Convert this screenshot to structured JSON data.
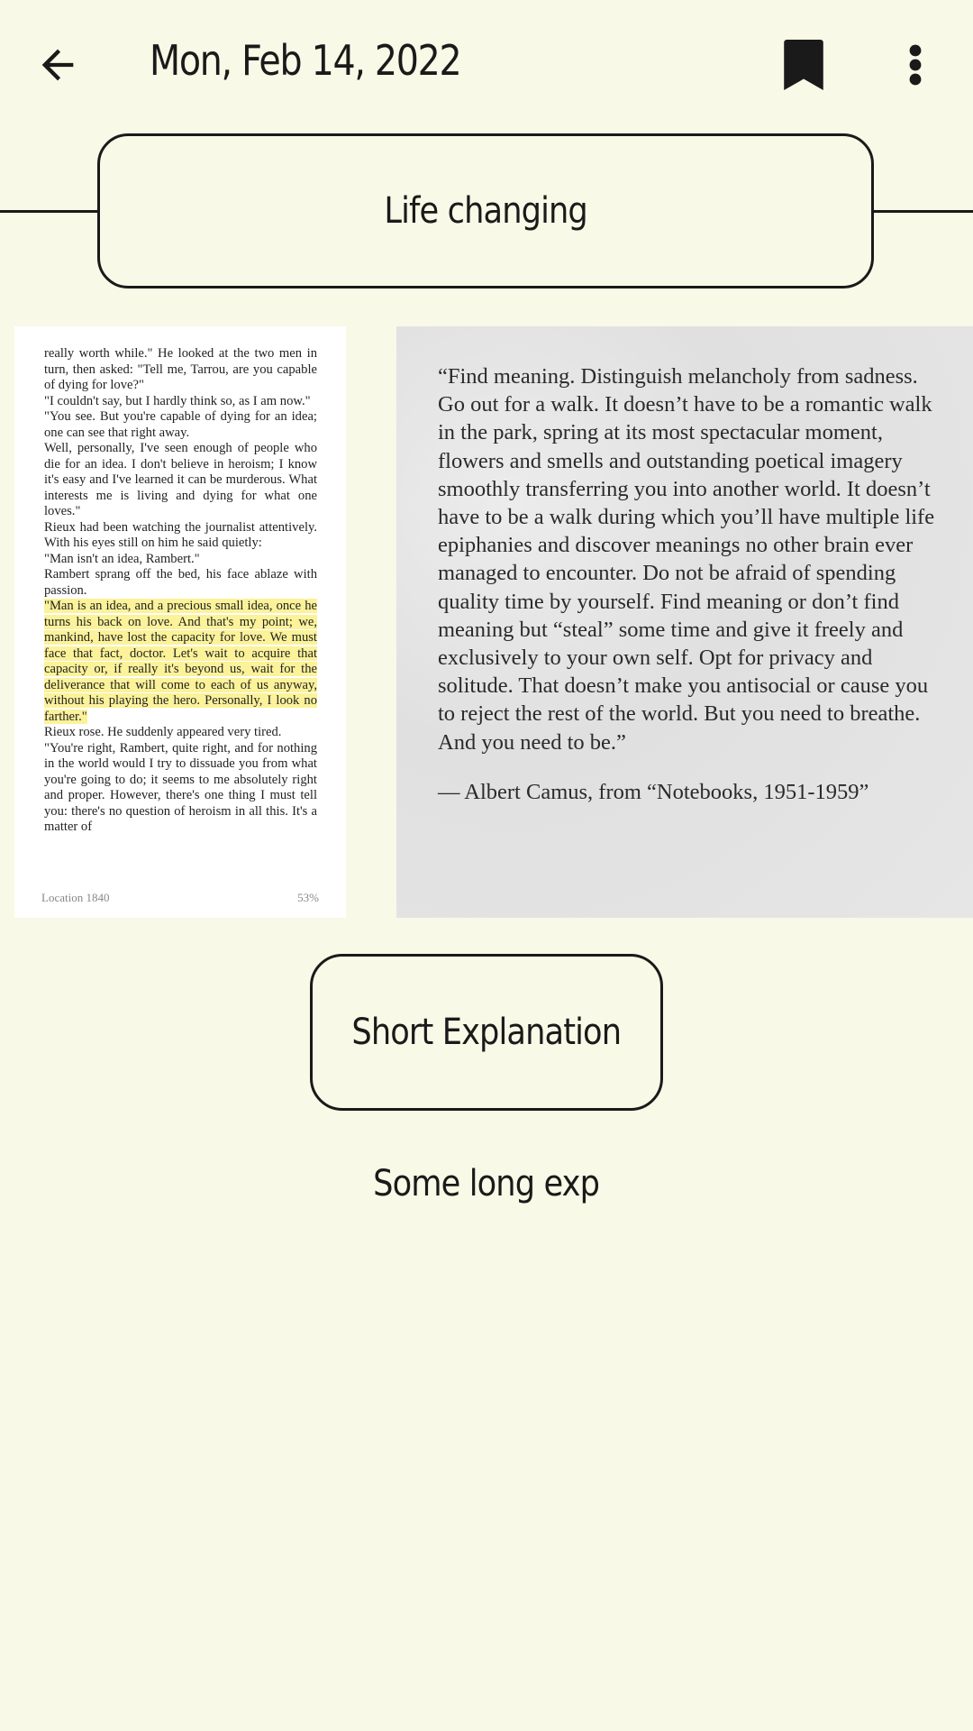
{
  "header": {
    "date": "Mon, Feb 14, 2022",
    "back_icon": "arrow-left-icon",
    "bookmark_icon": "bookmark-icon",
    "more_icon": "more-vert-icon"
  },
  "entry": {
    "title": "Life changing",
    "short_label": "Short Explanation",
    "long_explanation": "Some long exp"
  },
  "book_page": {
    "paragraphs": [
      "really worth while.\" He looked at the two men in turn, then asked: \"Tell me, Tarrou, are you capable of dying for love?\"",
      "\"I couldn't say, but I hardly think so, as I am now.\"",
      "\"You see. But you're capable of dying for an idea; one can see that right away.",
      "Well, personally, I've seen enough of people who die for an idea. I don't believe in heroism; I know it's easy and I've learned it can be murderous. What interests me is living and dying for what one loves.\"",
      "Rieux had been watching the journalist attentively. With his eyes still on him he said quietly:",
      "\"Man isn't an idea, Rambert.\"",
      "Rambert sprang off the bed, his face ablaze with passion."
    ],
    "highlight": "\"Man is an idea, and a precious small idea, once he turns his back on love. And that's my point; we, mankind, have lost the capacity for love. We must face that fact, doctor. Let's wait to acquire that capacity or, if really it's beyond us, wait for the deliverance that will come to each of us anyway, without his playing the hero. Personally, I look no farther.\"",
    "after": [
      "Rieux rose. He suddenly appeared very tired.",
      "\"You're right, Rambert, quite right, and for nothing in the world would I try to dissuade you from what you're going to do; it seems to me absolutely right and proper. However, there's one thing I must tell you: there's no question of heroism in all this. It's a matter of"
    ],
    "location": "Location 1840",
    "percent": "53%"
  },
  "quote": {
    "text": "“Find meaning. Distinguish melancholy from sadness. Go out for a walk. It doesn’t have to be a romantic walk in the park, spring at its most spectacular moment, flowers and smells and outstanding poetical imagery smoothly transferring you into another world. It doesn’t have to be a walk during which you’ll have multiple life epiphanies and discover meanings no other brain ever managed to encounter. Do not be afraid of spending quality time by yourself. Find meaning or don’t find meaning but “steal” some time and give it freely and exclusively to your own self. Opt for privacy and solitude. That doesn’t make you antisocial or cause you to reject the rest of the world. But you need to breathe. And you need to be.”",
    "attribution": "— Albert Camus, from “Notebooks, 1951-1959”"
  }
}
